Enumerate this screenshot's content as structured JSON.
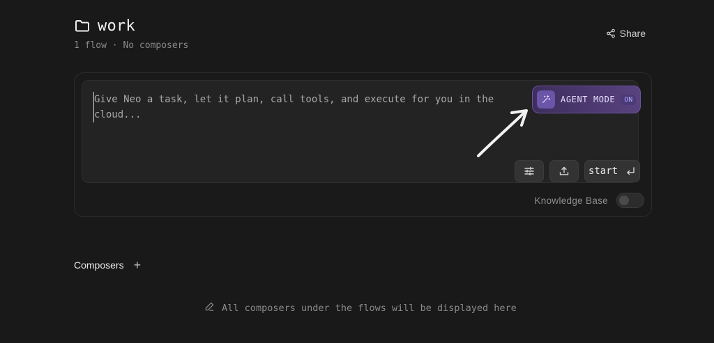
{
  "folder": {
    "name": "work",
    "meta": "1 flow · No composers",
    "icon": "folder-icon"
  },
  "share": {
    "label": "Share",
    "icon": "share-icon"
  },
  "prompt": {
    "placeholder": "Give Neo a task, let it plan, call tools, and execute for you in the cloud..."
  },
  "agent_mode": {
    "label": "AGENT MODE",
    "state": "ON",
    "icon": "magic-wand-icon",
    "accent": "#6b52a0"
  },
  "toolbar": {
    "settings_icon": "sliders-icon",
    "upload_icon": "upload-icon",
    "start_label": "start",
    "start_icon": "enter-icon"
  },
  "knowledge_base": {
    "label": "Knowledge Base",
    "enabled": false
  },
  "composers": {
    "title": "Composers",
    "add_label": "+",
    "empty_text": "All composers under the flows will be displayed here",
    "empty_icon": "pencil-icon"
  }
}
